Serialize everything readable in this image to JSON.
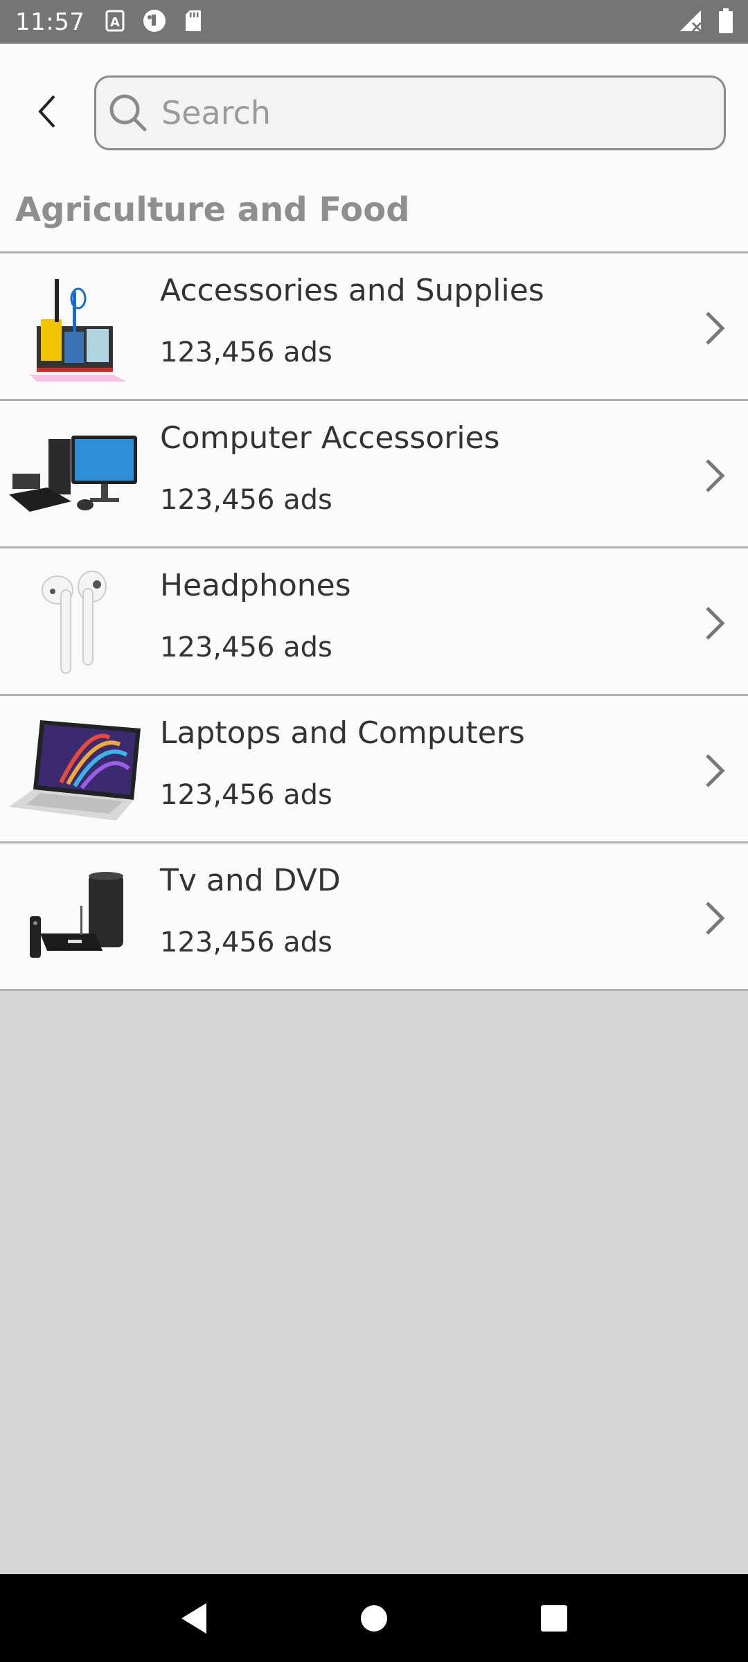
{
  "status_bar": {
    "time": "11:57",
    "left_icons": [
      "text-a-icon",
      "app-icon",
      "sd-card-icon"
    ],
    "right_icons": [
      "signal-off-icon",
      "battery-icon"
    ]
  },
  "header": {
    "back_icon": "back-arrow-icon",
    "search": {
      "placeholder": "Search",
      "value": ""
    }
  },
  "section": {
    "title": "Agriculture and Food"
  },
  "items": [
    {
      "title": "Accessories and Supplies",
      "count": "123,456 ads",
      "image": "desk-organizer"
    },
    {
      "title": "Computer Accessories",
      "count": "123,456 ads",
      "image": "desktop-computer"
    },
    {
      "title": "Headphones",
      "count": "123,456 ads",
      "image": "earbuds"
    },
    {
      "title": "Laptops and Computers",
      "count": "123,456 ads",
      "image": "laptop"
    },
    {
      "title": "Tv and DVD",
      "count": "123,456 ads",
      "image": "tv-box"
    }
  ],
  "nav_bar": {
    "buttons": [
      "back",
      "home",
      "recents"
    ]
  }
}
